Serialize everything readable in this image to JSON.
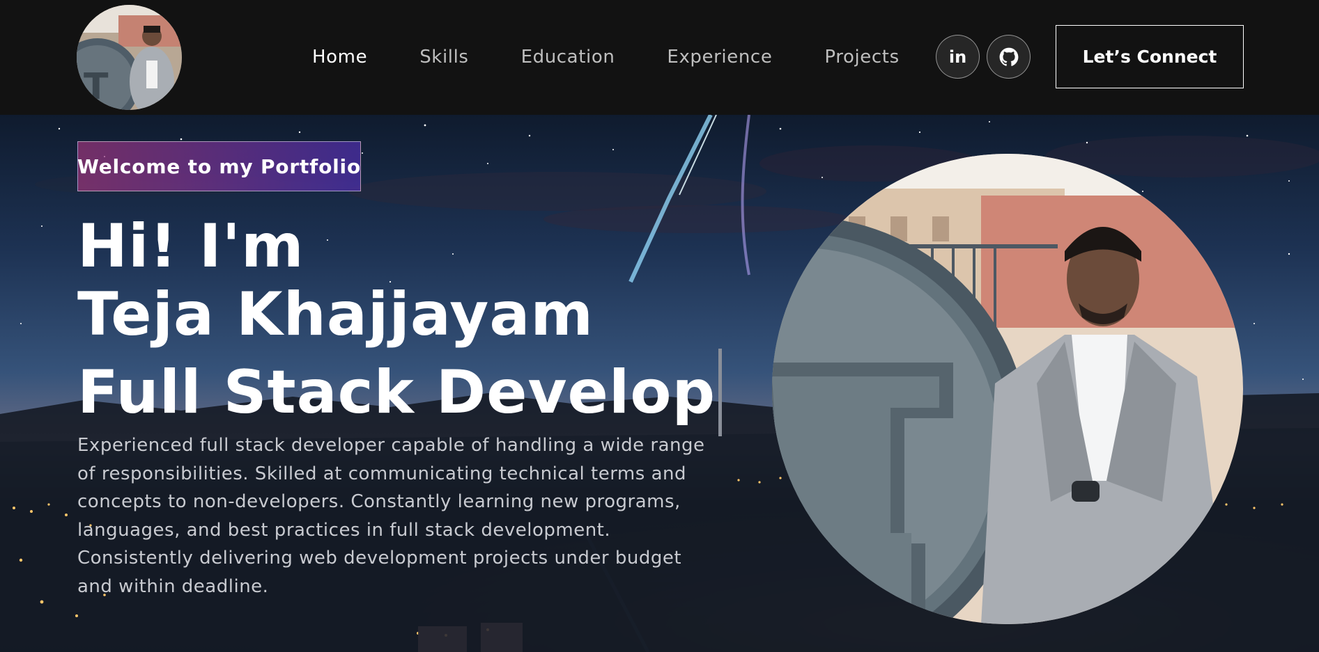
{
  "navbar": {
    "logo_alt": "profile-photo",
    "links": [
      {
        "label": "Home",
        "active": true
      },
      {
        "label": "Skills",
        "active": false
      },
      {
        "label": "Education",
        "active": false
      },
      {
        "label": "Experience",
        "active": false
      },
      {
        "label": "Projects",
        "active": false
      }
    ],
    "social": [
      {
        "icon": "linkedin-icon",
        "glyph": "in"
      },
      {
        "icon": "github-icon"
      }
    ],
    "connect_label": "Let’s Connect"
  },
  "hero": {
    "tagline": "Welcome to my Portfolio",
    "headline_line1": "Hi! I'm",
    "headline_line2": "Teja Khajjayam",
    "headline_line3": "Full Stack Develop",
    "description": "Experienced full stack developer capable of handling a wide range of responsibilities. Skilled at communicating technical terms and concepts to non-developers. Constantly learning new programs, languages, and best practices in full stack development. Consistently delivering web development projects under budget and within deadline.",
    "portrait_alt": "portrait-photo"
  },
  "colors": {
    "navbar_bg": "#121212",
    "badge_gradient_start": "#aa367c",
    "badge_gradient_end": "#4a2fbd",
    "text_primary": "#ffffff",
    "text_muted": "#c8cad0"
  }
}
